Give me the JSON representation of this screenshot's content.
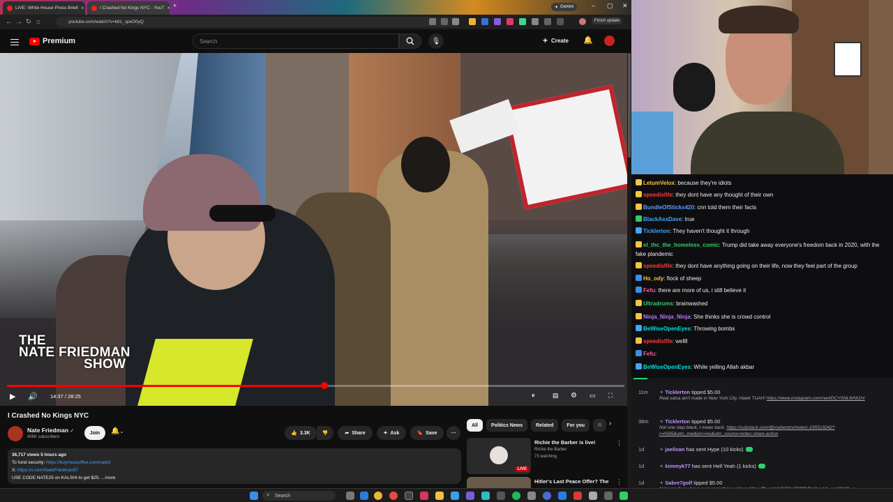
{
  "browser": {
    "tabs": [
      {
        "label": "LIVE: White House Press Briefi"
      },
      {
        "label": "I Crashed No Kings NYC - YouT"
      }
    ],
    "gemini_label": "Gemini",
    "url": "youtube.com/watch?v=k61_speD0yQ",
    "finish_update": "Finish update"
  },
  "youtube": {
    "logo_label": "Premium",
    "search_placeholder": "Search",
    "create_label": "Create",
    "video": {
      "watermark_line1": "THE",
      "watermark_line2": "NATE FRIEDMAN",
      "watermark_line3": "SHOW",
      "timecode": "14:37 / 28:25",
      "progress": 0.514
    },
    "title": "I Crashed No Kings NYC",
    "channel": {
      "name": "Nate Friedman",
      "verified": "✓",
      "subs": "405K subscribers"
    },
    "join_label": "Join",
    "actions": {
      "likes": "3.3K",
      "share": "Share",
      "ask": "Ask",
      "save": "Save"
    },
    "description": {
      "meta": "36,717 views  5 hours ago",
      "line2_prefix": "To fund security: ",
      "line2_link": "https://buymeacoffee.com/nate3",
      "line3_prefix": "X: ",
      "line3_link": "https://x.com/NateFriedman97",
      "line4": "USE CODE NATE25 on KALSHI to get $25. ...more"
    },
    "chips": [
      "All",
      "Politics News",
      "Related",
      "For you",
      "R"
    ],
    "recommendations": [
      {
        "title": "Richie the Barber is live!",
        "channel": "Richie the Barber",
        "meta": "73 watching",
        "badge": "LIVE"
      },
      {
        "title": "Hitler's Last Peace Offer? The",
        "channel": "",
        "meta": "",
        "badge": ""
      }
    ]
  },
  "chat": {
    "messages": [
      {
        "user": "LetumVelox",
        "color": "#f5c542",
        "text": "because they're idiots"
      },
      {
        "user": "speedisfife",
        "color": "#ff3b3b",
        "text": "they dont have any thought of their own"
      },
      {
        "user": "BundleOfSticks420",
        "color": "#5b9bff",
        "text": "cnn told them their facts"
      },
      {
        "user": "BlackAssDave",
        "color": "#3ea6ff",
        "text": "true"
      },
      {
        "user": "Ticklerton",
        "color": "#3ea6ff",
        "text": "They haven't thought it through"
      },
      {
        "user": "el_thc_the_homeless_comic",
        "color": "#2ecc71",
        "text": "Trump did take away everyone's freedom back in 2020, with the fake plandemic"
      },
      {
        "user": "speedisfife",
        "color": "#ff3b3b",
        "text": "they dont have anything going on their life, now they feel part of the group"
      },
      {
        "user": "Ho_ody",
        "color": "#f5c542",
        "text": "flock of sheep"
      },
      {
        "user": "Fefu",
        "color": "#ff5aa0",
        "text": "there are more of us, i still believe it"
      },
      {
        "user": "Ultradrums",
        "color": "#2ecc71",
        "text": "brainwashed"
      },
      {
        "user": "Ninja_Ninja_Ninja",
        "color": "#b57bff",
        "text": "She thinks she is crowd control"
      },
      {
        "user": "BeWiseOpenEyes",
        "color": "#00e0e0",
        "text": "Throwing bombs"
      },
      {
        "user": "speedisfife",
        "color": "#ff3b3b",
        "text": "wellll"
      },
      {
        "user": "Fefu",
        "color": "#ff5aa0",
        "text": ""
      },
      {
        "user": "BeWiseOpenEyes",
        "color": "#00e0e0",
        "text": "While yelling Allah akbar"
      }
    ]
  },
  "events": [
    {
      "time": "11m",
      "user": "Ticklerton",
      "action": "tipped $5.00",
      "sub": "Real salsa ain't made in New York City. Hawk TUAH!",
      "link": "https://www.instagram.com/reel/DCYSNLWNI1H/"
    },
    {
      "time": "38m",
      "user": "Ticklerton",
      "action": "tipped $5.00",
      "sub": "Not one step black, I mean back.",
      "link": "https://substack.com/@roybentzvi/note/c-235519242?r=h565&utm_medium=ios&utm_source=notes-share-action"
    },
    {
      "time": "1d",
      "user": "joelivan",
      "action": "has sent Hype (10 kicks)",
      "sub": "",
      "link": ""
    },
    {
      "time": "1d",
      "user": "kimmyk77",
      "action": "has sent Hell Yeah (1 kicks)",
      "sub": "",
      "link": ""
    },
    {
      "time": "1d",
      "user": "Sabre7golf",
      "action": "tipped $5.00",
      "sub": "Not sure if you have ever seen these videos",
      "link": "https://fb.watch/G7StoZOf3D/?mibextid=wwXIfr&fs=e"
    }
  ],
  "taskbar": {
    "search_placeholder": "Search"
  }
}
